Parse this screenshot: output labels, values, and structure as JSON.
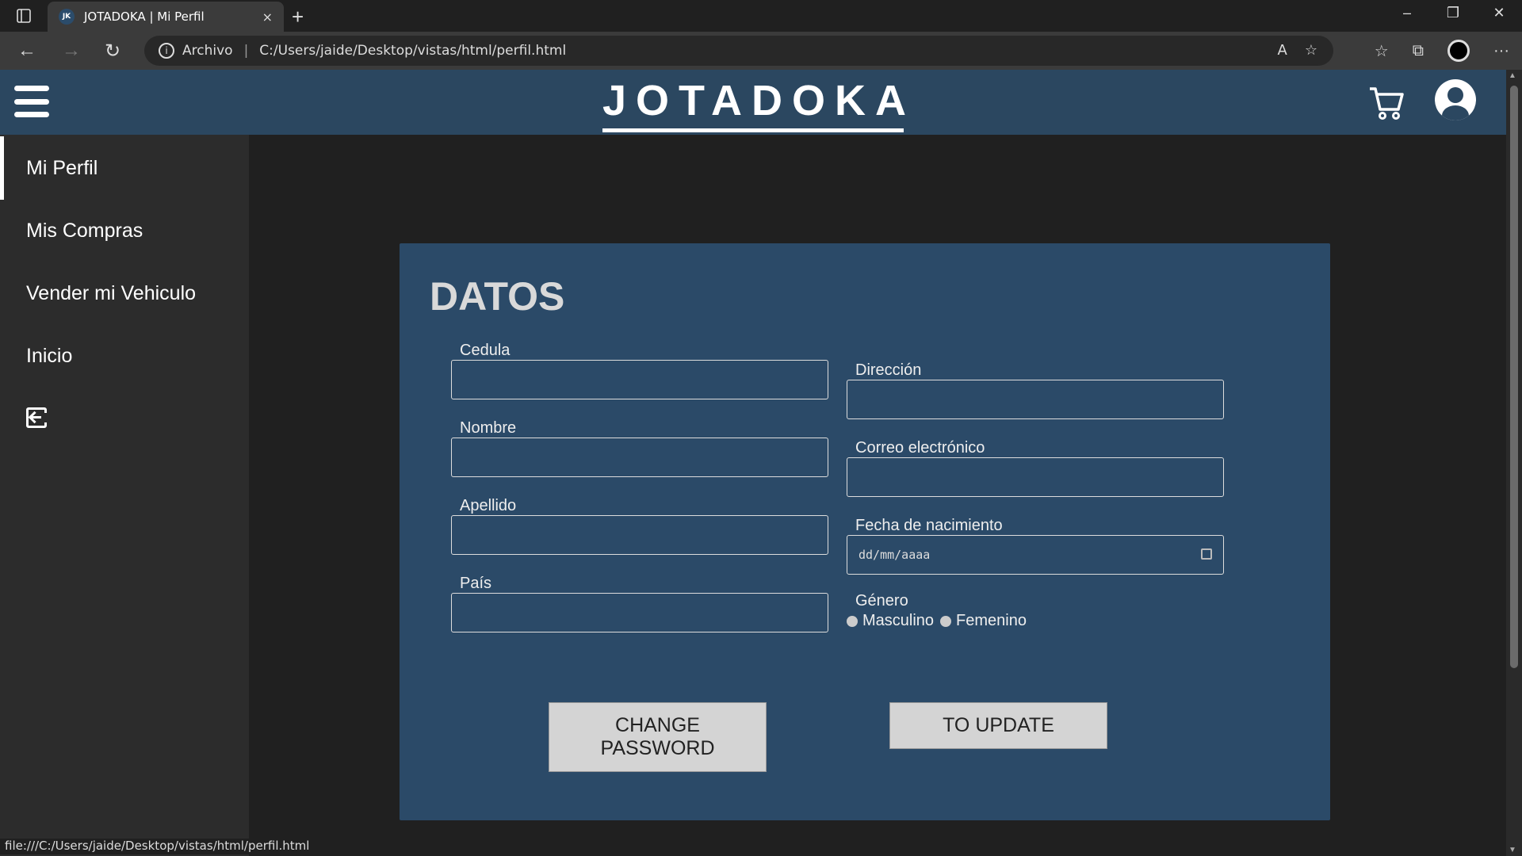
{
  "browser": {
    "tab_title": "JOTADOKA | Mi Perfil",
    "tab_favicon": "JK",
    "tab_close": "×",
    "new_tab": "+",
    "address_prefix": "Archivo",
    "address_url": "C:/Users/jaide/Desktop/vistas/html/perfil.html",
    "status_url": "file:///C:/Users/jaide/Desktop/vistas/html/perfil.html"
  },
  "header": {
    "brand": "JOTADOKA"
  },
  "sidebar": {
    "items": [
      {
        "label": "Mi Perfil",
        "active": true
      },
      {
        "label": "Mis Compras"
      },
      {
        "label": "Vender mi Vehiculo"
      },
      {
        "label": "Inicio"
      }
    ]
  },
  "form": {
    "title": "DATOS",
    "cedula_label": "Cedula",
    "nombre_label": "Nombre",
    "apellido_label": "Apellido",
    "pais_label": "País",
    "direccion_label": "Dirección",
    "correo_label": "Correo electrónico",
    "fecha_label": "Fecha de nacimiento",
    "fecha_placeholder": "dd/mm/aaaa",
    "genero_label": "Género",
    "genero_options": [
      "Masculino",
      "Femenino"
    ],
    "change_password_label": "CHANGE PASSWORD",
    "update_label": "TO UPDATE"
  },
  "colors": {
    "header_bg": "#2b4760",
    "card_bg": "#2b4a68",
    "sidebar_bg": "#2c2c2c",
    "page_bg": "#202020",
    "button_bg": "#d4d4d4"
  }
}
